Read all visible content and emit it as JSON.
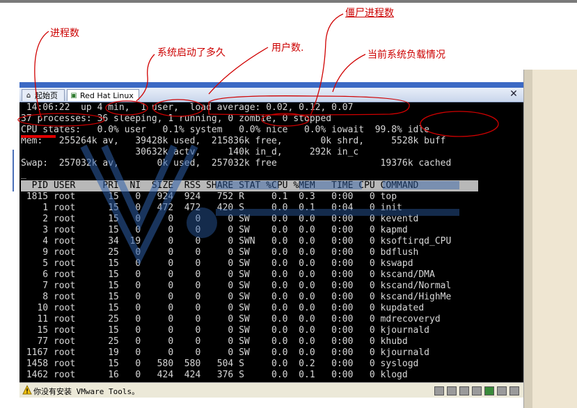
{
  "annotations": {
    "processes": "进程数",
    "uptime": "系统启动了多久",
    "zombie": "僵尸进程数",
    "users": "用户数.",
    "load": "当前系统负载情况"
  },
  "tabs": [
    {
      "label": "起始页",
      "icon": "home-icon"
    },
    {
      "label": "Red Hat Linux",
      "icon": "vm-icon"
    }
  ],
  "terminal": {
    "summary": [
      " 14:06:22  up 4 min,  1 user,  load average: 0.02, 0.12, 0.07",
      "37 processes: 36 sleeping, 1 running, 0 zombie, 0 stopped",
      "CPU states:   0.0% user   0.1% system   0.0% nice   0.0% iowait  99.8% idle",
      "Mem:   255264k av,   39428k used,  215836k free,       0k shrd,     5528k buff",
      "                     30632k actv,     140k in_d,     292k in_c",
      "Swap:  257032k av,       0k used,  257032k free                   19376k cached",
      "_"
    ],
    "header": "  PID USER     PRI  NI  SIZE  RSS SHARE STAT %CPU %MEM   TIME CPU COMMAND",
    "processes": [
      " 1815 root      15   0   924  924   752 R     0.1  0.3   0:00   0 top",
      "    1 root      15   0   472  472   420 S     0.0  0.1   0:04   0 init",
      "    2 root      15   0     0    0     0 SW    0.0  0.0   0:00   0 keventd",
      "    3 root      15   0     0    0     0 SW    0.0  0.0   0:00   0 kapmd",
      "    4 root      34  19     0    0     0 SWN   0.0  0.0   0:00   0 ksoftirqd_CPU",
      "    9 root      25   0     0    0     0 SW    0.0  0.0   0:00   0 bdflush",
      "    5 root      15   0     0    0     0 SW    0.0  0.0   0:00   0 kswapd",
      "    6 root      15   0     0    0     0 SW    0.0  0.0   0:00   0 kscand/DMA",
      "    7 root      15   0     0    0     0 SW    0.0  0.0   0:00   0 kscand/Normal",
      "    8 root      15   0     0    0     0 SW    0.0  0.0   0:00   0 kscand/HighMe",
      "   10 root      15   0     0    0     0 SW    0.0  0.0   0:00   0 kupdated",
      "   11 root      25   0     0    0     0 SW    0.0  0.0   0:00   0 mdrecoveryd",
      "   15 root      15   0     0    0     0 SW    0.0  0.0   0:00   0 kjournald",
      "   77 root      25   0     0    0     0 SW    0.0  0.0   0:00   0 khubd",
      " 1167 root      19   0     0    0     0 SW    0.0  0.0   0:00   0 kjournald",
      " 1458 root      15   0   580  580   504 S     0.0  0.2   0:00   0 syslogd",
      " 1462 root      16   0   424  424   376 S     0.0  0.1   0:00   0 klogd"
    ]
  },
  "statusbar": {
    "message": "你没有安装 VMware Tools。"
  },
  "colors": {
    "annotation": "#cc0000",
    "terminal_bg": "#000000",
    "terminal_fg": "#d8d8d8"
  }
}
